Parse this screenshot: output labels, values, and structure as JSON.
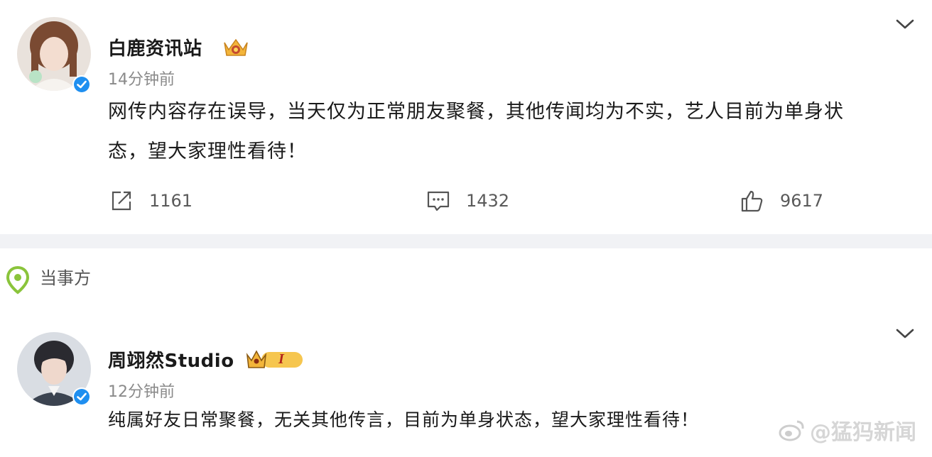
{
  "post1": {
    "username": "白鹿资讯站",
    "time": "14分钟前",
    "content_line1": "网传内容存在误导，当天仅为正常朋友聚餐，其他传闻均为不实，艺人目前为单身状",
    "content_line2": "态，望大家理性看待！",
    "badge_icon": "crown-badge-icon",
    "actions": {
      "share_count": "1161",
      "comment_count": "1432",
      "like_count": "9617"
    }
  },
  "section": {
    "label": "当事方",
    "icon": "location-pin-icon"
  },
  "post2": {
    "username": "周翊然Studio",
    "time": "12分钟前",
    "badge_text": "I",
    "content": "纯属好友日常聚餐，无关其他传言，目前为单身状态，望大家理性看待！"
  },
  "watermark": {
    "text": "@猛犸新闻"
  },
  "colors": {
    "accent_blue": "#1f8ff0",
    "badge_gold": "#f3b53a",
    "divider": "#f1f2f5",
    "pin_green": "#8ac43b"
  }
}
